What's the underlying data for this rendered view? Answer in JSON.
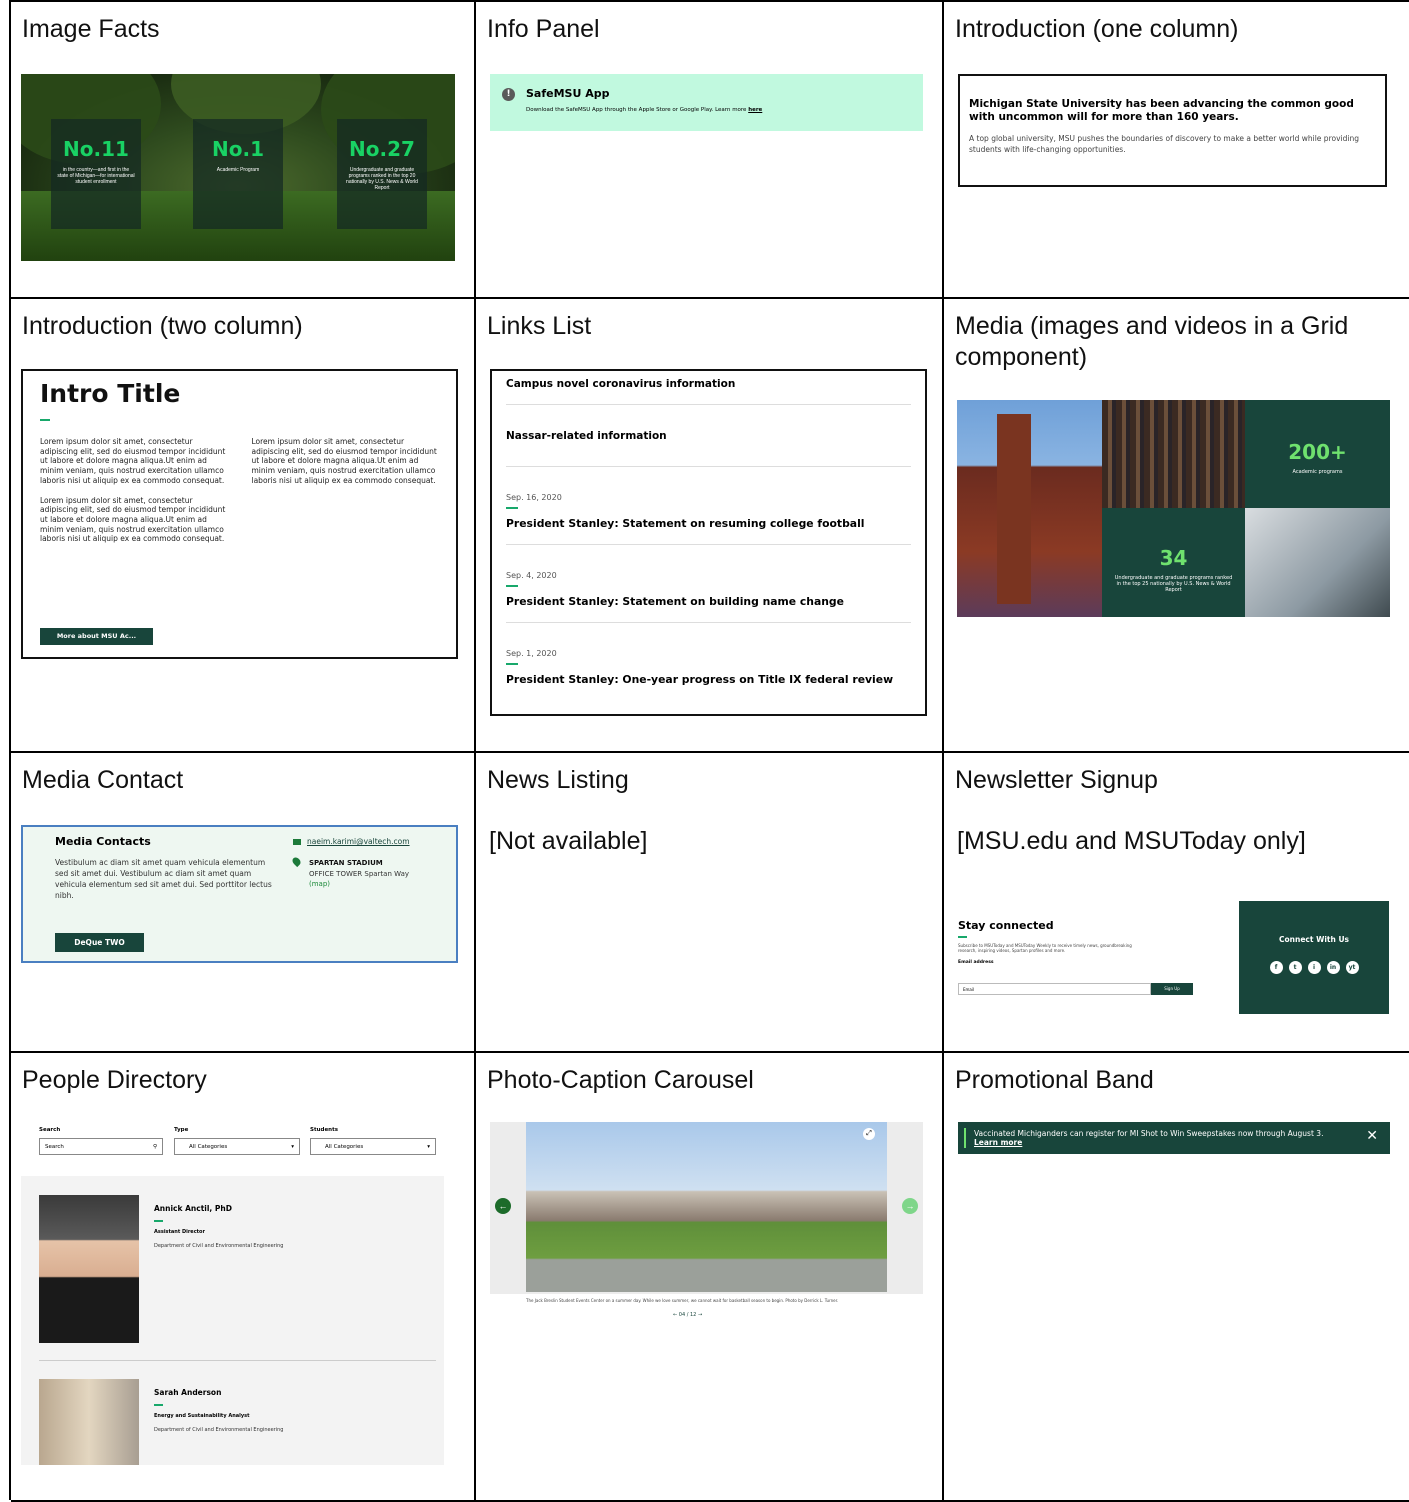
{
  "cells": {
    "image_facts": "Image Facts",
    "info_panel": "Info Panel",
    "intro_one": "Introduction (one column)",
    "intro_two": "Introduction (two column)",
    "links_list": "Links List",
    "media": "Media (images and videos in a Grid component)",
    "media_contact": "Media Contact",
    "news_listing": "News Listing",
    "newsletter": "Newsletter Signup",
    "people": "People Directory",
    "carousel": "Photo-Caption Carousel",
    "promo": "Promotional Band"
  },
  "facts": [
    {
      "num": "No.11",
      "text": "in the country—and first in the state of Michigan—for international student enrollment"
    },
    {
      "num": "No.1",
      "text": "Academic Program"
    },
    {
      "num": "No.27",
      "text": "Undergraduate and graduate programs ranked in the top 20 nationally by U.S. News & World Report"
    }
  ],
  "info": {
    "title": "SafeMSU App",
    "text": "Download the SafeMSU App through the Apple Store or Google Play. Learn more ",
    "link": "here"
  },
  "intro_one": {
    "heading": "Michigan State University has been advancing the common good with uncommon will for more than 160 years.",
    "body": "A top global university, MSU pushes the boundaries of discovery to make a better world while providing students with life-changing opportunities."
  },
  "intro_two": {
    "title": "Intro Title",
    "para": "Lorem ipsum dolor sit amet, consectetur adipiscing elit, sed do eiusmod tempor incididunt ut labore et dolore magna aliqua.Ut enim ad minim veniam, quis nostrud exercitation ullamco laboris nisi ut aliquip ex ea commodo consequat.",
    "button": "More about MSU Ac..."
  },
  "links": {
    "top1": "Campus novel coronavirus information",
    "top2": "Nassar-related information",
    "items": [
      {
        "date": "Sep. 16, 2020",
        "title": "President Stanley: Statement on resuming college football"
      },
      {
        "date": "Sep. 4, 2020",
        "title": "President Stanley: Statement on building name change"
      },
      {
        "date": "Sep. 1, 2020",
        "title": "President Stanley: One-year progress on Title IX federal review"
      }
    ]
  },
  "media_grid": {
    "stat1": "200+",
    "stat1_label": "Academic programs",
    "stat2": "34",
    "stat2_label": "Undergraduate and graduate programs ranked in the top 25 nationally by U.S. News & World Report"
  },
  "media_contact": {
    "heading": "Media Contacts",
    "body": "Vestibulum ac diam sit amet quam vehicula elementum sed sit amet dui. Vestibulum ac diam sit amet quam vehicula elementum sed sit amet dui. Sed porttitor lectus nibh.",
    "button": "DeQue TWO",
    "email": "naeim.karimi@valtech.com",
    "place": "SPARTAN STADIUM",
    "address": "OFFICE TOWER Spartan Way",
    "map": "(map)"
  },
  "news_listing": "[Not available]",
  "newsletter": {
    "note": "[MSU.edu and MSUToday only]",
    "heading": "Stay connected",
    "text": "Subscribe to MSUToday and MSUToday Weekly to receive timely news, groundbreaking research, inspiring videos, Spartan profiles and more.",
    "label": "Email address",
    "placeholder": "Email",
    "button": "Sign Up",
    "connect": "Connect With Us",
    "social": [
      "f",
      "t",
      "i",
      "in",
      "yt"
    ]
  },
  "people": {
    "search_label": "Search",
    "search_placeholder": "Search",
    "type_label": "Type",
    "type_value": "All Categories",
    "students_label": "Students",
    "students_value": "All Categories",
    "persons": [
      {
        "name": "Annick Anctil, PhD",
        "role": "Assistant Director",
        "dept": "Department of Civil and Environmental Engineering"
      },
      {
        "name": "Sarah Anderson",
        "role": "Energy and Sustainability Analyst",
        "dept": "Department of Civil and Environmental Engineering"
      }
    ]
  },
  "carousel": {
    "caption": "The Jack Breslin Student Events Center on a summer day. While we love summer, we cannot wait for basketball season to begin. Photo by Derrick L. Turner.",
    "pager": "← 04 / 12 →"
  },
  "promo": {
    "text": "Vaccinated Michiganders can register for MI Shot to Win Sweepstakes now through August 3. ",
    "link": "Learn more"
  }
}
